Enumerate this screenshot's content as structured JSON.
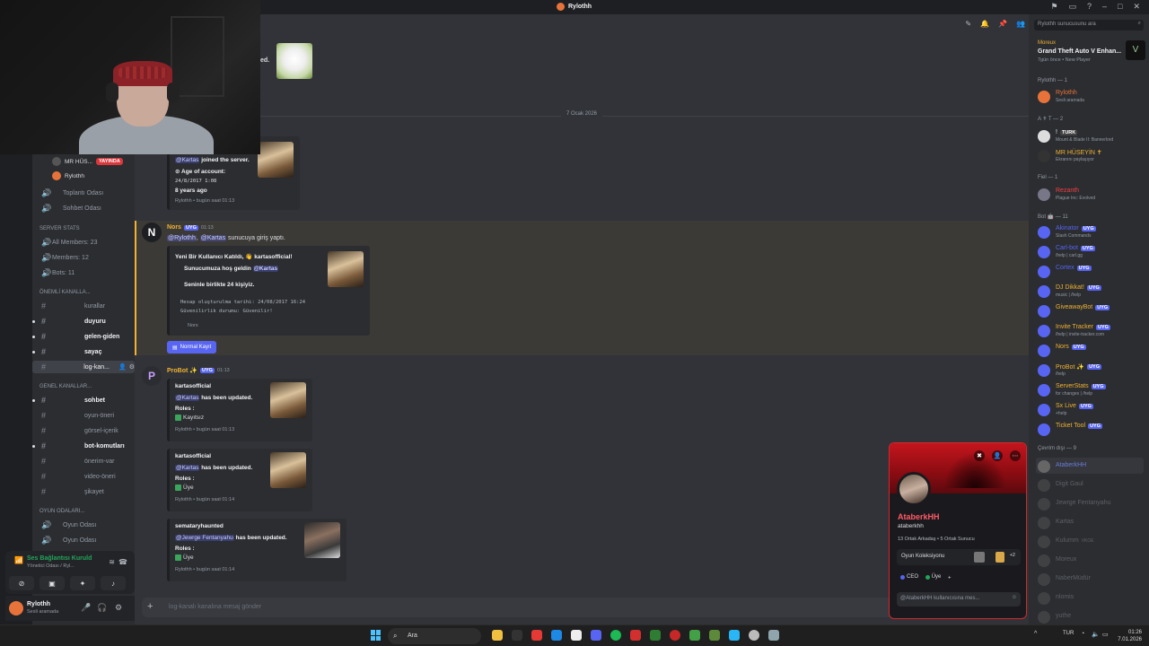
{
  "window": {
    "title": "Rylothh"
  },
  "voice_users": [
    {
      "name": "MR HÜS...",
      "badge": "YAYINDA"
    },
    {
      "name": "Rylothh"
    }
  ],
  "voice_channels_top": [
    {
      "name": "Toplantı Odası"
    },
    {
      "name": "Sohbet Odası"
    }
  ],
  "categories": {
    "server_stats": "SERVER STATS",
    "onemli": "ÖNEMLİ KANALLA...",
    "genel": "GENEL KANALLAR...",
    "oyun": "OYUN ODALARI..."
  },
  "stats_channels": [
    "All Members: 23",
    "Members: 12",
    "Bots: 11"
  ],
  "important_channels": [
    "kurallar",
    "duyuru",
    "gelen-giden",
    "sayaç",
    "log-kan..."
  ],
  "general_channels": [
    "sohbet",
    "oyun-öneri",
    "görsel-içerik",
    "bot-komutları",
    "önerim-var",
    "video-öneri",
    "şikayet"
  ],
  "game_rooms": [
    "Oyun Odası",
    "Oyun Odası"
  ],
  "voice_panel": {
    "title": "Ses Bağlantısı Kuruld",
    "sub": "Yönetici Odası / Ryl..."
  },
  "user_panel": {
    "name": "Rylothh",
    "status": "Sesli aramada"
  },
  "chat": {
    "date_separator": "7 Ocak 2026",
    "top_text": "ed.",
    "welcome_embed": {
      "mention": "@Kartas",
      "joined": "joined the server.",
      "age_label": "Age of account:",
      "age_date": "24/8/2017 1:08",
      "years": "8 years ago",
      "footer": "Rylothh • bugün saat 01:13"
    },
    "nors_msg": {
      "author": "Nors",
      "tag": "UYG",
      "time": "01:13",
      "text_mention1": "@Rylothh",
      "text_mention2": "@Kartas",
      "text": "sunucuya giriş yaptı.",
      "embed_title": "Yeni Bir Kullanıcı Katıldı, 👋 kartasofficial!",
      "embed_welcome": "Sunucumuza hoş geldin",
      "embed_welcome_mention": "@Kartas",
      "embed_count": "Seninle birlikte 24 kişiyiz.",
      "embed_created": "Hesap oluşturulma tarihi: 24/08/2017 16:24",
      "embed_trust": "Güvenilirlik durumu:",
      "embed_trust_val": "Güvenilir!",
      "embed_footer": "Nors",
      "button": "Normal Kayıt"
    },
    "probot_msg": {
      "author": "ProBot ✨",
      "tag": "UYG",
      "time": "01:13",
      "embeds": [
        {
          "user": "kartasofficial",
          "mention": "@Kartas",
          "action": "has been updated.",
          "roles_label": "Roles :",
          "role": "Kayıtsız",
          "footer": "Rylothh • bugün saat 01:13"
        },
        {
          "user": "kartasofficial",
          "mention": "@Kartas",
          "action": "has been updated.",
          "roles_label": "Roles :",
          "role": "Üye",
          "footer": "Rylothh • bugün saat 01:14"
        },
        {
          "user": "semataryhaunted",
          "mention": "@Jewrge Fentanyahu",
          "action": "has been updated.",
          "roles_label": "Roles :",
          "role": "Üye",
          "footer": "Rylothh • bugün saat 01:14"
        }
      ]
    },
    "composer_placeholder": "log-kanalı kanalına mesaj gönder"
  },
  "members": {
    "search_placeholder": "Rylothh sunucusunu ara",
    "activity": {
      "user": "Moreux",
      "game": "Grand Theft Auto V Enhan...",
      "meta": "7gün önce • New Player"
    },
    "groups": {
      "rylothh": "Rylothh — 1",
      "at": "A ✝ T — 2",
      "fiel": "Fiel — 1",
      "bot": "Bot 🤖 — 11",
      "offline": "Çevrim dışı — 9"
    },
    "owner": [
      {
        "name": "Rylothh",
        "sub": "Sesli aramada",
        "color": "#e8733a"
      }
    ],
    "at": [
      {
        "name": "!",
        "badge": "TURK",
        "sub": "Mount & Blade II: Bannerlord",
        "color": "#f2f3f5"
      },
      {
        "name": "MR HÜSEYİN ✝",
        "sub": "Ekranını paylaşıyor",
        "color": "#f0b232"
      }
    ],
    "fiel": [
      {
        "name": "Rezanth",
        "sub": "Plague Inc: Evolved",
        "color": "#f23f43"
      }
    ],
    "bots": [
      {
        "name": "Akinator",
        "sub": "Slash Commands",
        "color": "#5865f2"
      },
      {
        "name": "Carl-bot",
        "sub": "/help | carl.gg",
        "color": "#5865f2"
      },
      {
        "name": "Cortex",
        "sub": "",
        "color": "#5865f2"
      },
      {
        "name": "DJ Dikkat!",
        "sub": "music | /help",
        "color": "#f0b232"
      },
      {
        "name": "GiveawayBot",
        "sub": "",
        "color": "#f0b232"
      },
      {
        "name": "Invite Tracker",
        "sub": "/help | invite-tracker.com",
        "color": "#f0b232"
      },
      {
        "name": "Nors",
        "sub": "",
        "color": "#f0b232"
      },
      {
        "name": "ProBot ✨",
        "sub": "/help",
        "color": "#f0b232"
      },
      {
        "name": "ServerStats",
        "sub": "for changes | /help",
        "color": "#f0b232"
      },
      {
        "name": "Sx Live",
        "sub": "+help",
        "color": "#f0b232"
      },
      {
        "name": "Ticket Tool",
        "sub": "",
        "color": "#f0b232"
      }
    ],
    "offline": [
      {
        "name": "AtaberkHH"
      },
      {
        "name": "Digit Gaul"
      },
      {
        "name": "Jewrge Fentanyahu"
      },
      {
        "name": "Kartas"
      },
      {
        "name": "Kulumm",
        "sub": "VKOE"
      },
      {
        "name": "Moreux"
      },
      {
        "name": "NaberMüdür"
      },
      {
        "name": "nlomis"
      },
      {
        "name": "yuthe"
      }
    ],
    "bot_tag": "UYG"
  },
  "profile_popout": {
    "display_name": "AtaberkHH",
    "username": "ataberkhh",
    "mutual": "13 Ortak Arkadaş • 5 Ortak Sunucu",
    "collection_label": "Oyun Koleksiyonu",
    "collection_more": "+2",
    "roles": [
      {
        "name": "CEO",
        "color": "#5865f2"
      },
      {
        "name": "Üye",
        "color": "#23a55a"
      }
    ],
    "message_placeholder": "@AtaberkHH kullanıcısına mes..."
  },
  "taskbar": {
    "search_placeholder": "Ara",
    "lang": "TUR",
    "time": "01:26",
    "date": "7.01.2026"
  }
}
